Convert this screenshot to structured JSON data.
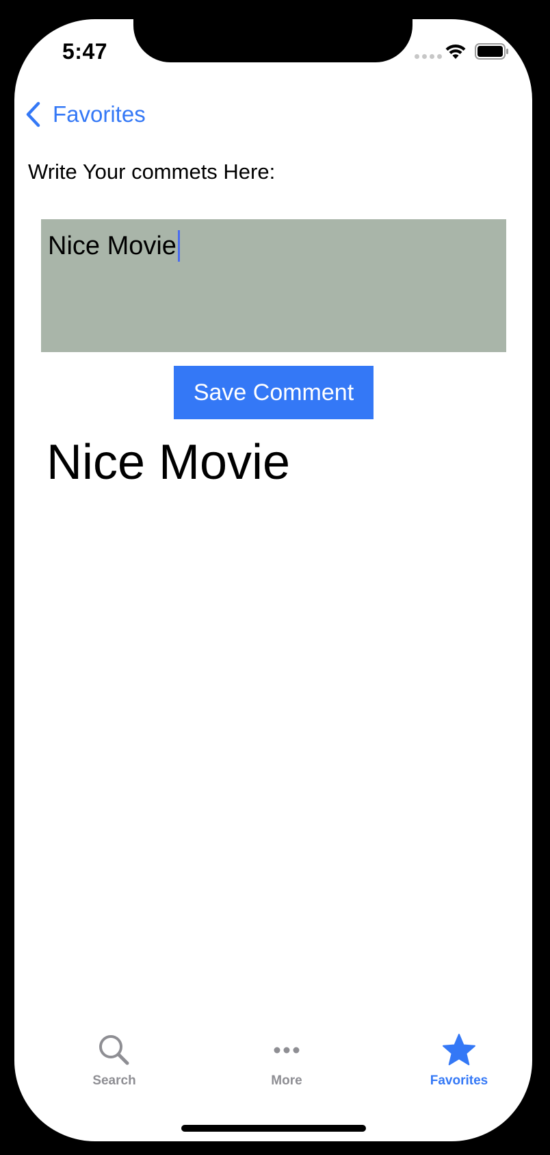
{
  "status_bar": {
    "time": "5:47"
  },
  "nav": {
    "back_label": "Favorites"
  },
  "form": {
    "instructions": "Write Your commets Here:",
    "comment_value": "Nice Movie",
    "save_label": "Save Comment"
  },
  "saved_comment": "Nice Movie",
  "tab_bar": {
    "tabs": [
      {
        "label": "Search",
        "icon": "search-icon",
        "selected": false
      },
      {
        "label": "More",
        "icon": "more-icon",
        "selected": false
      },
      {
        "label": "Favorites",
        "icon": "star-icon",
        "selected": true
      }
    ]
  },
  "colors": {
    "accent": "#3478f6",
    "tab_inactive": "#8e8e93",
    "comment_box": "#a9b5a9",
    "caret": "#4a6cf0"
  }
}
